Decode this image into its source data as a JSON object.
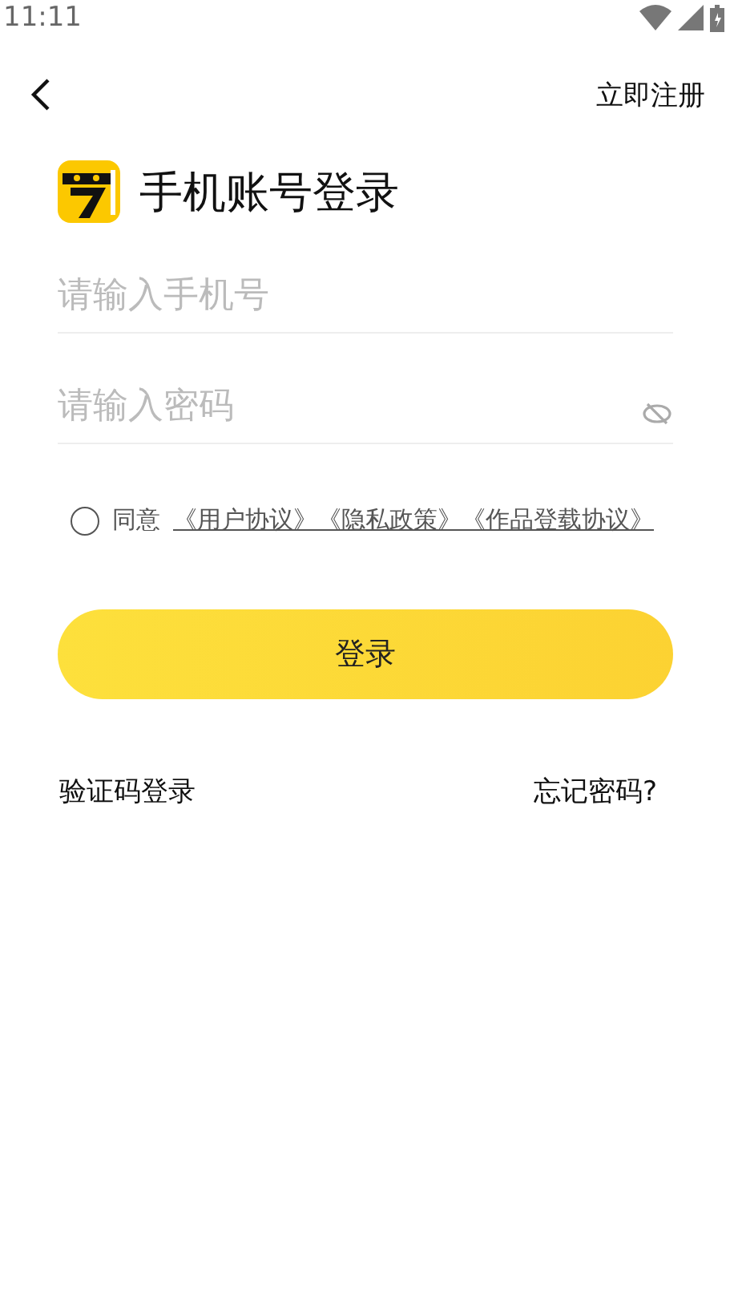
{
  "status_bar": {
    "time": "11:11"
  },
  "header": {
    "action": "立即注册"
  },
  "title": "手机账号登录",
  "fields": [
    {
      "placeholder": "请输入手机号",
      "kind": "phone"
    },
    {
      "placeholder": "请输入密码",
      "kind": "password"
    }
  ],
  "agreement": {
    "checked": false,
    "prefix": "同意",
    "links": [
      "《用户协议》",
      "《隐私政策》",
      "《作品登载协议》"
    ]
  },
  "login_button": "登录",
  "footer": {
    "left": "验证码登录",
    "right": "忘记密码?"
  }
}
